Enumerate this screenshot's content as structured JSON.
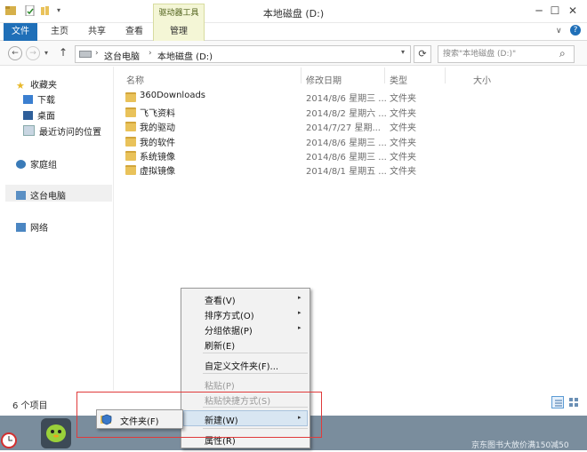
{
  "window": {
    "title": "本地磁盘 (D:)",
    "contextual_tab_group": "驱动器工具",
    "controls": {
      "minimize": "─",
      "maximize": "☐",
      "close": "✕"
    }
  },
  "ribbon": {
    "tabs": [
      "文件",
      "主页",
      "共享",
      "查看",
      "管理"
    ],
    "collapse": "∨",
    "help": "?"
  },
  "navigation": {
    "back": "←",
    "forward": "→",
    "recent": "▾",
    "up": "↑",
    "breadcrumb": [
      "这台电脑",
      "本地磁盘 (D:)"
    ],
    "separator": "›",
    "dropdown": "▾",
    "refresh": "⟳",
    "search_placeholder": "搜索\"本地磁盘 (D:)\"",
    "search_icon": "⌕"
  },
  "nav_pane": {
    "favorites": "收藏夹",
    "favorites_items": [
      "下载",
      "桌面",
      "最近访问的位置"
    ],
    "homegroup": "家庭组",
    "this_pc": "这台电脑",
    "network": "网络"
  },
  "file_list": {
    "columns": [
      "名称",
      "修改日期",
      "类型",
      "大小"
    ],
    "rows": [
      {
        "name": "360Downloads",
        "date": "2014/8/6 星期三 ...",
        "type": "文件夹"
      },
      {
        "name": "飞飞资料",
        "date": "2014/8/2 星期六 ...",
        "type": "文件夹"
      },
      {
        "name": "我的驱动",
        "date": "2014/7/27 星期...",
        "type": "文件夹"
      },
      {
        "name": "我的软件",
        "date": "2014/8/6 星期三 ...",
        "type": "文件夹"
      },
      {
        "name": "系统镜像",
        "date": "2014/8/6 星期三 ...",
        "type": "文件夹"
      },
      {
        "name": "虚拟镜像",
        "date": "2014/8/1 星期五 ...",
        "type": "文件夹"
      }
    ]
  },
  "status_bar": {
    "item_count": "6 个项目"
  },
  "context_menu": {
    "items": [
      {
        "label": "查看(V)",
        "submenu": true,
        "disabled": false
      },
      {
        "label": "排序方式(O)",
        "submenu": true,
        "disabled": false
      },
      {
        "label": "分组依据(P)",
        "submenu": true,
        "disabled": false
      },
      {
        "label": "刷新(E)",
        "submenu": false,
        "disabled": false
      },
      {
        "label": "自定义文件夹(F)...",
        "submenu": false,
        "disabled": false
      },
      {
        "label": "粘贴(P)",
        "submenu": false,
        "disabled": true
      },
      {
        "label": "粘贴快捷方式(S)",
        "submenu": false,
        "disabled": true
      },
      {
        "label": "新建(W)",
        "submenu": true,
        "disabled": false
      },
      {
        "label": "属性(R)",
        "submenu": false,
        "disabled": false
      }
    ],
    "submenu_arrow": "▸"
  },
  "new_submenu": {
    "items": [
      "文件夹(F)"
    ]
  },
  "taskbar": {
    "watermark": "京东图书大放价满150减50"
  },
  "colors": {
    "accent": "#1f6fb8",
    "contextual_tab": "#f4f6d6",
    "highlight_border": "#e03a3a",
    "taskbar": "#7a8d9d",
    "folder": "#e9c25a"
  }
}
